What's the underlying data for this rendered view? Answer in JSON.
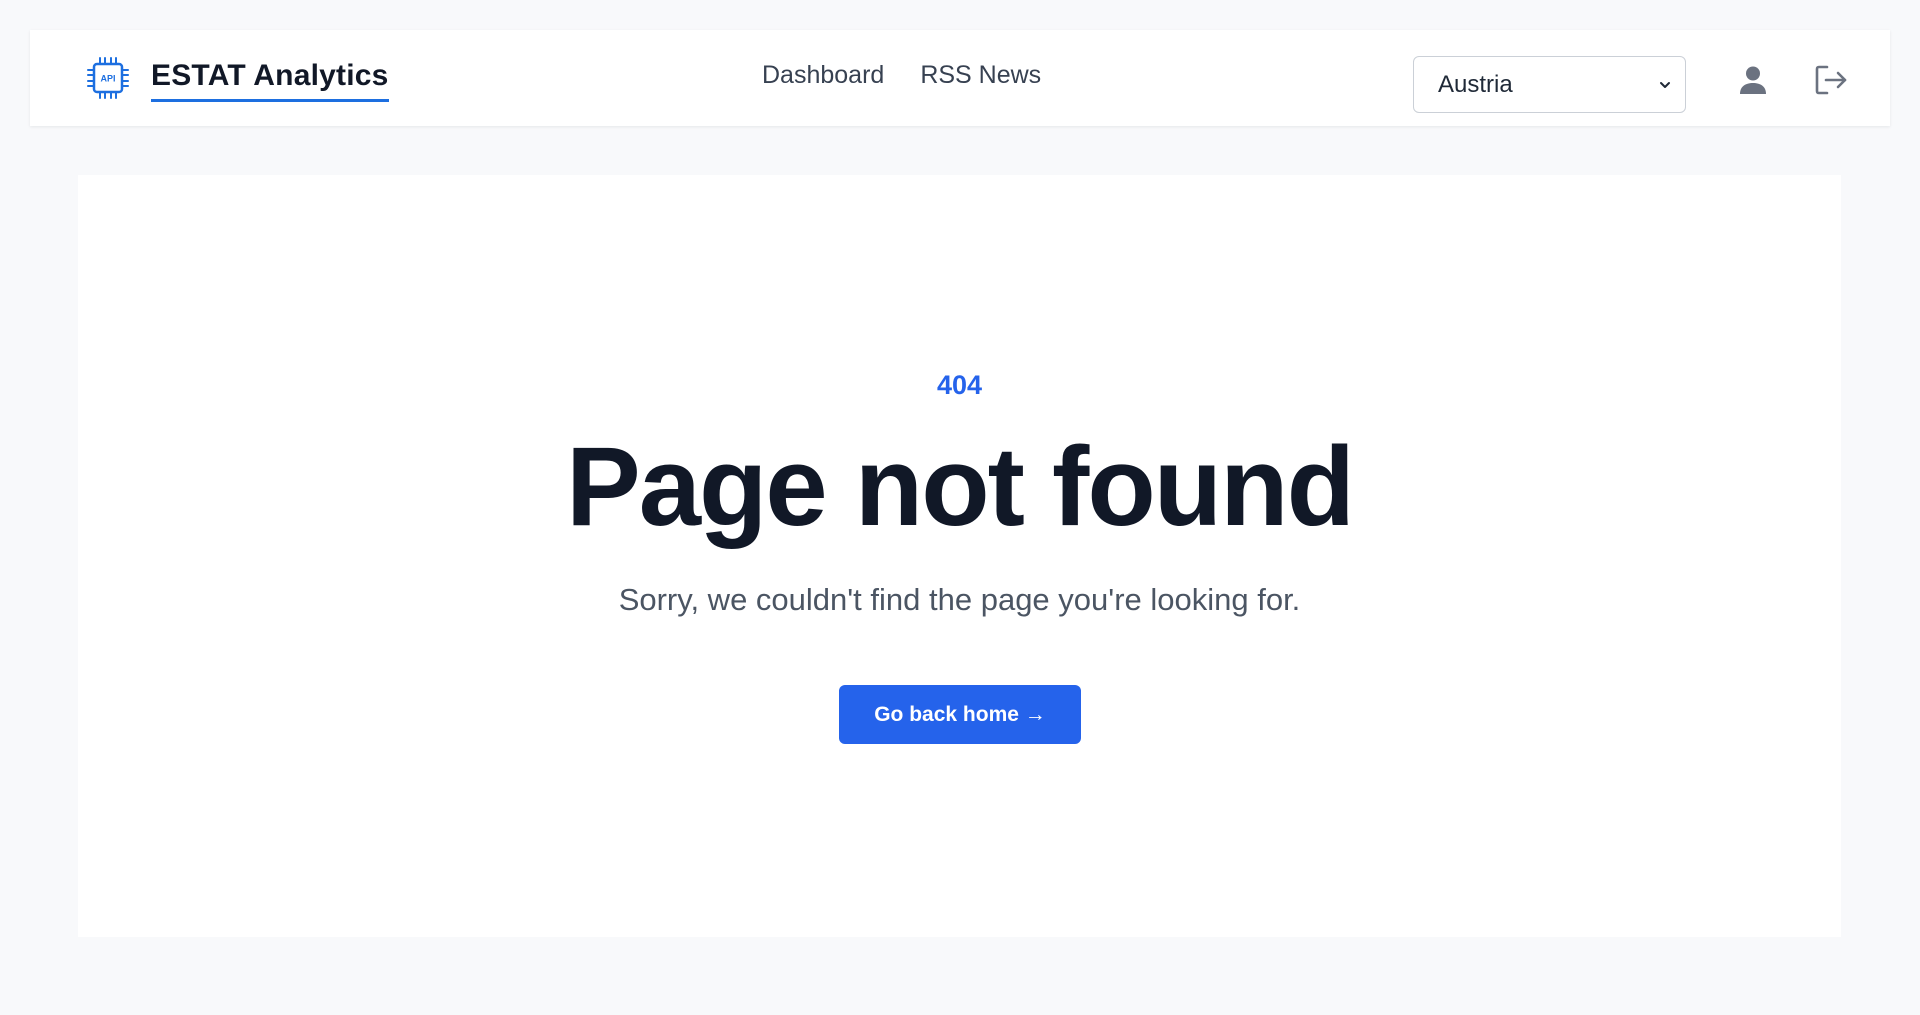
{
  "navbar": {
    "brand_icon": "chip-api-icon",
    "brand_icon_text": "API",
    "brand_title": "ESTAT Analytics",
    "links": [
      {
        "label": "Dashboard"
      },
      {
        "label": "RSS News"
      }
    ],
    "country_select": {
      "selected": "Austria"
    },
    "user_icon": "user-icon",
    "logout_icon": "logout-icon"
  },
  "main": {
    "error_code": "404",
    "title": "Page not found",
    "subtitle": "Sorry, we couldn't find the page you're looking for.",
    "home_button_label": "Go back home →"
  },
  "colors": {
    "accent": "#2563eb",
    "brand_underline": "#1d6fe0",
    "page_background": "#f8f9fb",
    "title_text": "#111827",
    "subtitle_text": "#4b5563"
  }
}
